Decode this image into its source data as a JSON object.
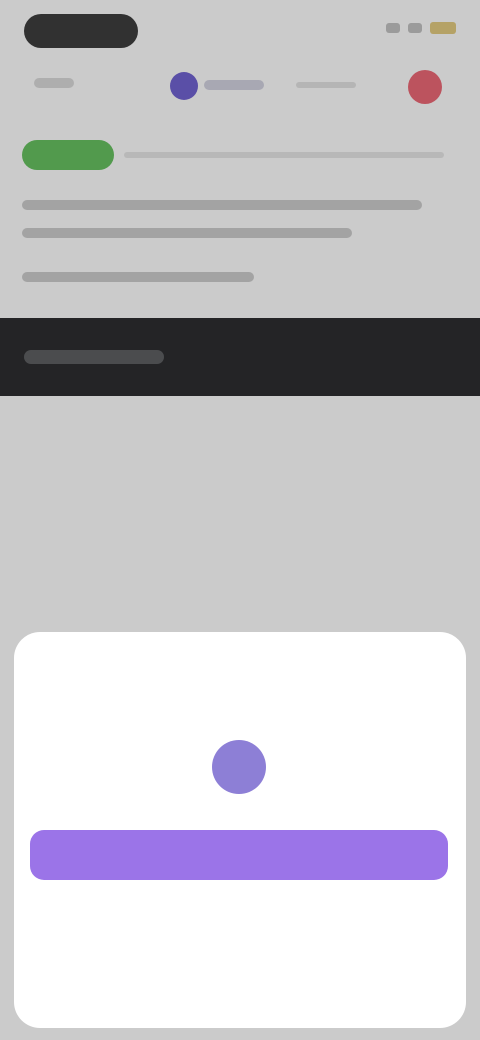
{
  "modal": {
    "title": "",
    "primary_button_label": "",
    "secondary_link": "",
    "cancel_label": ""
  },
  "colors": {
    "accent": "#9b74e8",
    "tag_green": "#62b85c",
    "nav_action": "#e16470",
    "dark_bar": "#2b2c2e"
  }
}
